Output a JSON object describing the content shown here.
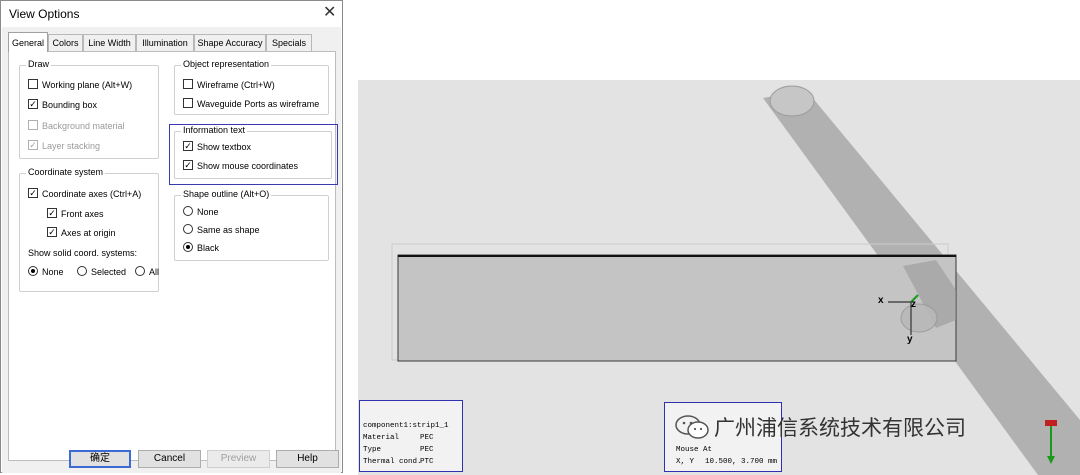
{
  "dialog": {
    "title": "View Options",
    "close_glyph": "✕",
    "tabs": [
      "General",
      "Colors",
      "Line Width",
      "Illumination",
      "Shape Accuracy",
      "Specials"
    ],
    "active_tab": "General",
    "draw": {
      "title": "Draw",
      "items": [
        {
          "label": "Working plane (Alt+W)",
          "checked": false,
          "disabled": false
        },
        {
          "label": "Bounding box",
          "checked": true,
          "disabled": false
        },
        {
          "label": "Background material",
          "checked": false,
          "disabled": true
        },
        {
          "label": "Layer stacking",
          "checked": true,
          "disabled": true
        }
      ]
    },
    "coordinate_system": {
      "title": "Coordinate system",
      "axes": {
        "label": "Coordinate axes (Ctrl+A)",
        "checked": true
      },
      "front_axes": {
        "label": "Front axes",
        "checked": true
      },
      "axes_at_origin": {
        "label": "Axes at origin",
        "checked": true
      },
      "solid_label": "Show solid coord. systems:",
      "solid_options": [
        "None",
        "Selected",
        "All"
      ],
      "solid_selected": "None"
    },
    "object_representation": {
      "title": "Object representation",
      "items": [
        {
          "label": "Wireframe (Ctrl+W)",
          "checked": false
        },
        {
          "label": "Waveguide Ports as wireframe",
          "checked": false
        }
      ]
    },
    "information_text": {
      "title": "Information text",
      "items": [
        {
          "label": "Show textbox",
          "checked": true
        },
        {
          "label": "Show mouse coordinates",
          "checked": true
        }
      ],
      "highlight_color": "#3a3ab0"
    },
    "shape_outline": {
      "title": "Shape outline (Alt+O)",
      "options": [
        "None",
        "Same as shape",
        "Black"
      ],
      "selected": "Black"
    },
    "buttons": {
      "ok": "确定",
      "cancel": "Cancel",
      "preview": "Preview",
      "help": "Help"
    }
  },
  "viewport": {
    "background": "#e3e3e3",
    "axes": {
      "x": "x",
      "z": "z",
      "y": "y"
    },
    "component_info": {
      "name": "component1:strip1_1",
      "rows": [
        {
          "key": "Material",
          "value": "PEC"
        },
        {
          "key": "Type",
          "value": "PEC"
        },
        {
          "key": "Thermal cond.",
          "value": "PTC"
        }
      ]
    },
    "mouse_info": {
      "title": "Mouse At",
      "label": "X, Y",
      "value": "10.500,  3.700 mm"
    },
    "watermark": {
      "text": "广州浦信系统技术有限公司",
      "icon": "wechat-icon"
    }
  }
}
